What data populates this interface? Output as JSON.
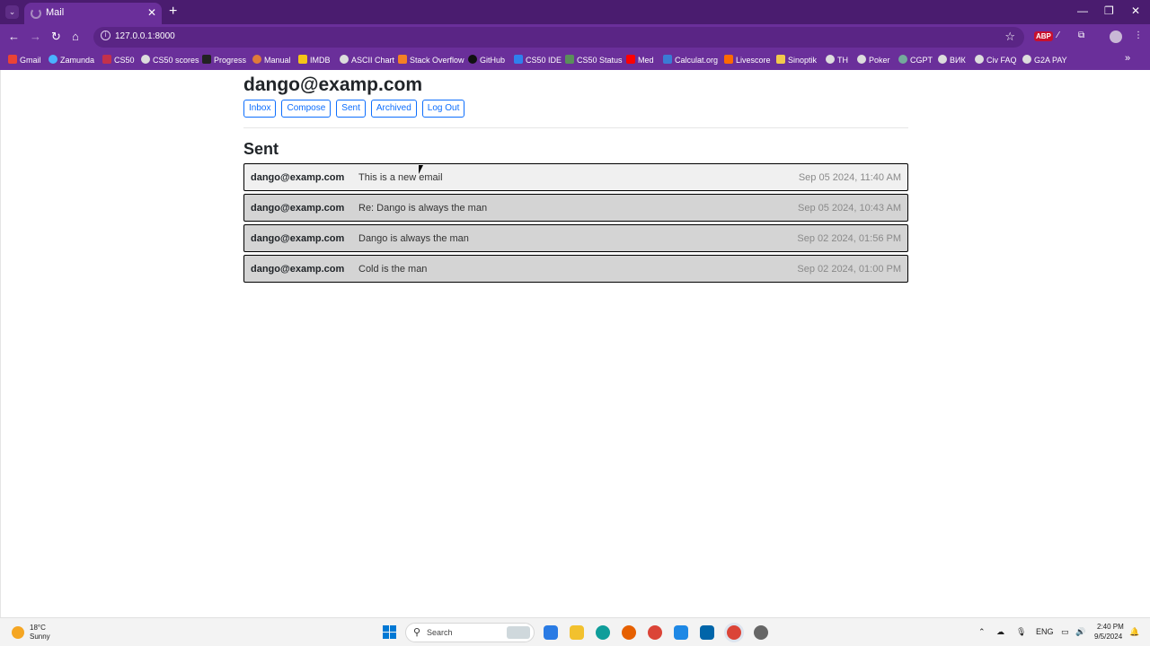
{
  "browser": {
    "tab_title": "Mail",
    "url": "127.0.0.1:8000",
    "bookmarks": [
      "Gmail",
      "Zamunda",
      "CS50",
      "CS50 scores",
      "Progress",
      "Manual",
      "IMDB",
      "ASCII Chart",
      "Stack Overflow",
      "GitHub",
      "CS50 IDE",
      "CS50 Status",
      "Med",
      "Calculat.org",
      "Livescore",
      "Sinoptik",
      "TH",
      "Poker",
      "CGPT",
      "ВИК",
      "Civ FAQ",
      "G2A PAY"
    ]
  },
  "app": {
    "user_email": "dango@examp.com",
    "nav": {
      "inbox": "Inbox",
      "compose": "Compose",
      "sent": "Sent",
      "archived": "Archived",
      "logout": "Log Out"
    },
    "mailbox_title": "Sent",
    "emails": [
      {
        "sender": "dango@examp.com",
        "subject": "This is a new email",
        "timestamp": "Sep 05 2024, 11:40 AM",
        "bg": "#f0f0f0"
      },
      {
        "sender": "dango@examp.com",
        "subject": "Re: Dango is always the man",
        "timestamp": "Sep 05 2024, 10:43 AM",
        "bg": "#d4d4d4"
      },
      {
        "sender": "dango@examp.com",
        "subject": "Dango is always the man",
        "timestamp": "Sep 02 2024, 01:56 PM",
        "bg": "#d4d4d4"
      },
      {
        "sender": "dango@examp.com",
        "subject": "Cold is the man",
        "timestamp": "Sep 02 2024, 01:00 PM",
        "bg": "#d4d4d4"
      }
    ]
  },
  "taskbar": {
    "weather_temp": "18°C",
    "weather_cond": "Sunny",
    "search_label": "Search",
    "lang": "ENG",
    "time": "2:40 PM",
    "date": "9/5/2024"
  }
}
